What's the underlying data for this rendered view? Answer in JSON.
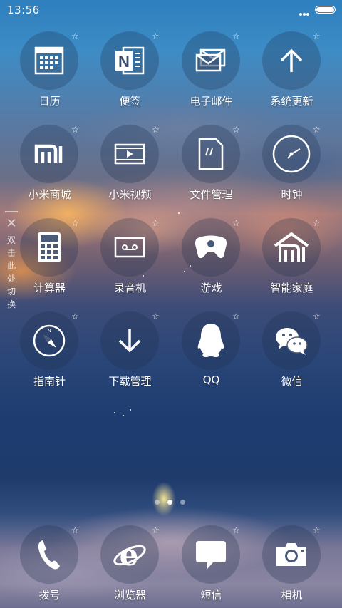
{
  "status_bar": {
    "time": "13:56",
    "battery_level": 1.0
  },
  "side_hint": {
    "chars": [
      "双",
      "击",
      "此",
      "处",
      "切",
      "换"
    ]
  },
  "apps": [
    {
      "label": "日历",
      "icon": "calendar-icon"
    },
    {
      "label": "便签",
      "icon": "notes-icon"
    },
    {
      "label": "电子邮件",
      "icon": "email-icon"
    },
    {
      "label": "系统更新",
      "icon": "update-arrow-icon"
    },
    {
      "label": "小米商城",
      "icon": "mi-store-icon"
    },
    {
      "label": "小米视频",
      "icon": "video-play-icon"
    },
    {
      "label": "文件管理",
      "icon": "file-manager-icon"
    },
    {
      "label": "时钟",
      "icon": "clock-icon"
    },
    {
      "label": "计算器",
      "icon": "calculator-icon"
    },
    {
      "label": "录音机",
      "icon": "recorder-icon"
    },
    {
      "label": "游戏",
      "icon": "gamepad-icon"
    },
    {
      "label": "智能家庭",
      "icon": "smart-home-icon"
    },
    {
      "label": "指南针",
      "icon": "compass-icon"
    },
    {
      "label": "下载管理",
      "icon": "download-icon"
    },
    {
      "label": "QQ",
      "icon": "qq-penguin-icon"
    },
    {
      "label": "微信",
      "icon": "wechat-icon"
    }
  ],
  "dock": [
    {
      "label": "拨号",
      "icon": "phone-icon"
    },
    {
      "label": "浏览器",
      "icon": "browser-icon"
    },
    {
      "label": "短信",
      "icon": "sms-icon"
    },
    {
      "label": "相机",
      "icon": "camera-icon"
    }
  ],
  "pager": {
    "pages": 3,
    "current": 2
  }
}
